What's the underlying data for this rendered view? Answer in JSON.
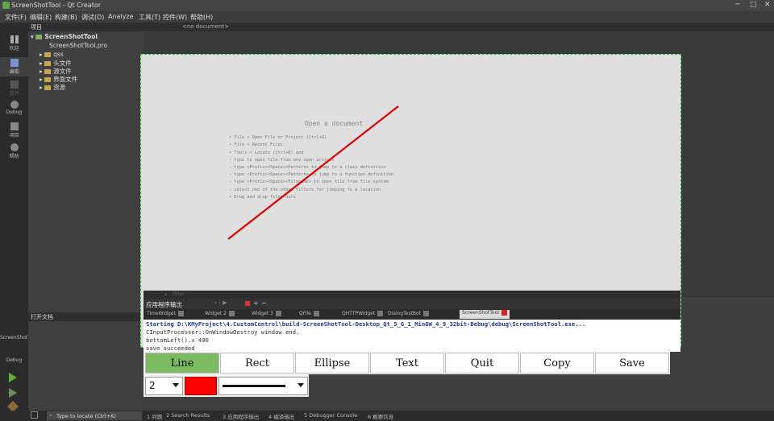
{
  "window": {
    "title": "ScreenShotTool - Qt Creator",
    "min": "─",
    "max": "□",
    "close": "✕"
  },
  "menu": [
    "文件(F)",
    "编辑(E)",
    "构建(B)",
    "调试(D)",
    "Analyze",
    "工具(T)",
    "控件(W)",
    "帮助(H)"
  ],
  "modes": [
    "欢迎",
    "编辑",
    "设计",
    "Debug",
    "项目",
    "帮助"
  ],
  "project_pane": {
    "header": "项目",
    "items": [
      "ScreenShotTool",
      "ScreenShotTool.pro",
      "qss",
      "头文件",
      "源文件",
      "界面文件",
      "资源"
    ]
  },
  "open_docs_header": "打开文档",
  "editor_header": "<no document>",
  "welcome": {
    "title": "Open a document",
    "lines": [
      "• File > Open File or Project (Ctrl+O)",
      "• File > Recent Files",
      "• Tools > Locate (Ctrl+K) and",
      "  - type to open file from any open project",
      "  - type <Prefix><Space><Pattern> to jump to a class definition",
      "  - type <Prefix><Space><Pattern> to jump to a function definition",
      "  - type <Prefix><Space><Filename> to open file from file system",
      "  - select one of the other filters for jumping to a location",
      "• Drag and drop files here"
    ]
  },
  "findbar": {
    "placeholder": "Filter"
  },
  "output_header": "应用程序输出",
  "output_tabs": [
    "TimeWidget",
    "Widget 2",
    "Widget 3",
    "QFile",
    "QHTTPWidget",
    "DialogTestBot",
    "ScreenShotTool"
  ],
  "output_lines": [
    "Starting D:\\KMyProject\\4.CustomControl\\build-ScreenShotTool-Desktop_Qt_5_6_1_MinGW_4_9_32bit-Debug\\debug\\ScreenShotTool.exe...",
    "CInputProcessor::OnWindowDestroy window end.",
    "bottomLeft().x 490",
    "save succeeded"
  ],
  "tools": {
    "buttons": [
      "Line",
      "Rect",
      "Ellipse",
      "Text",
      "Quit",
      "Copy",
      "Save"
    ],
    "active": "Line",
    "size": "2",
    "color": "#ff0000"
  },
  "left_bottom": {
    "project": "ScreenShotTool",
    "config": "Debug"
  },
  "statusbar": {
    "locator_placeholder": "Type to locate (Ctrl+K)",
    "items": [
      "1 问题",
      "2 Search Results",
      "3 应用程序输出",
      "4 编译输出",
      "5 Debugger Console",
      "6 概要信息"
    ]
  },
  "drawn_line": {
    "color": "#dd0000"
  }
}
